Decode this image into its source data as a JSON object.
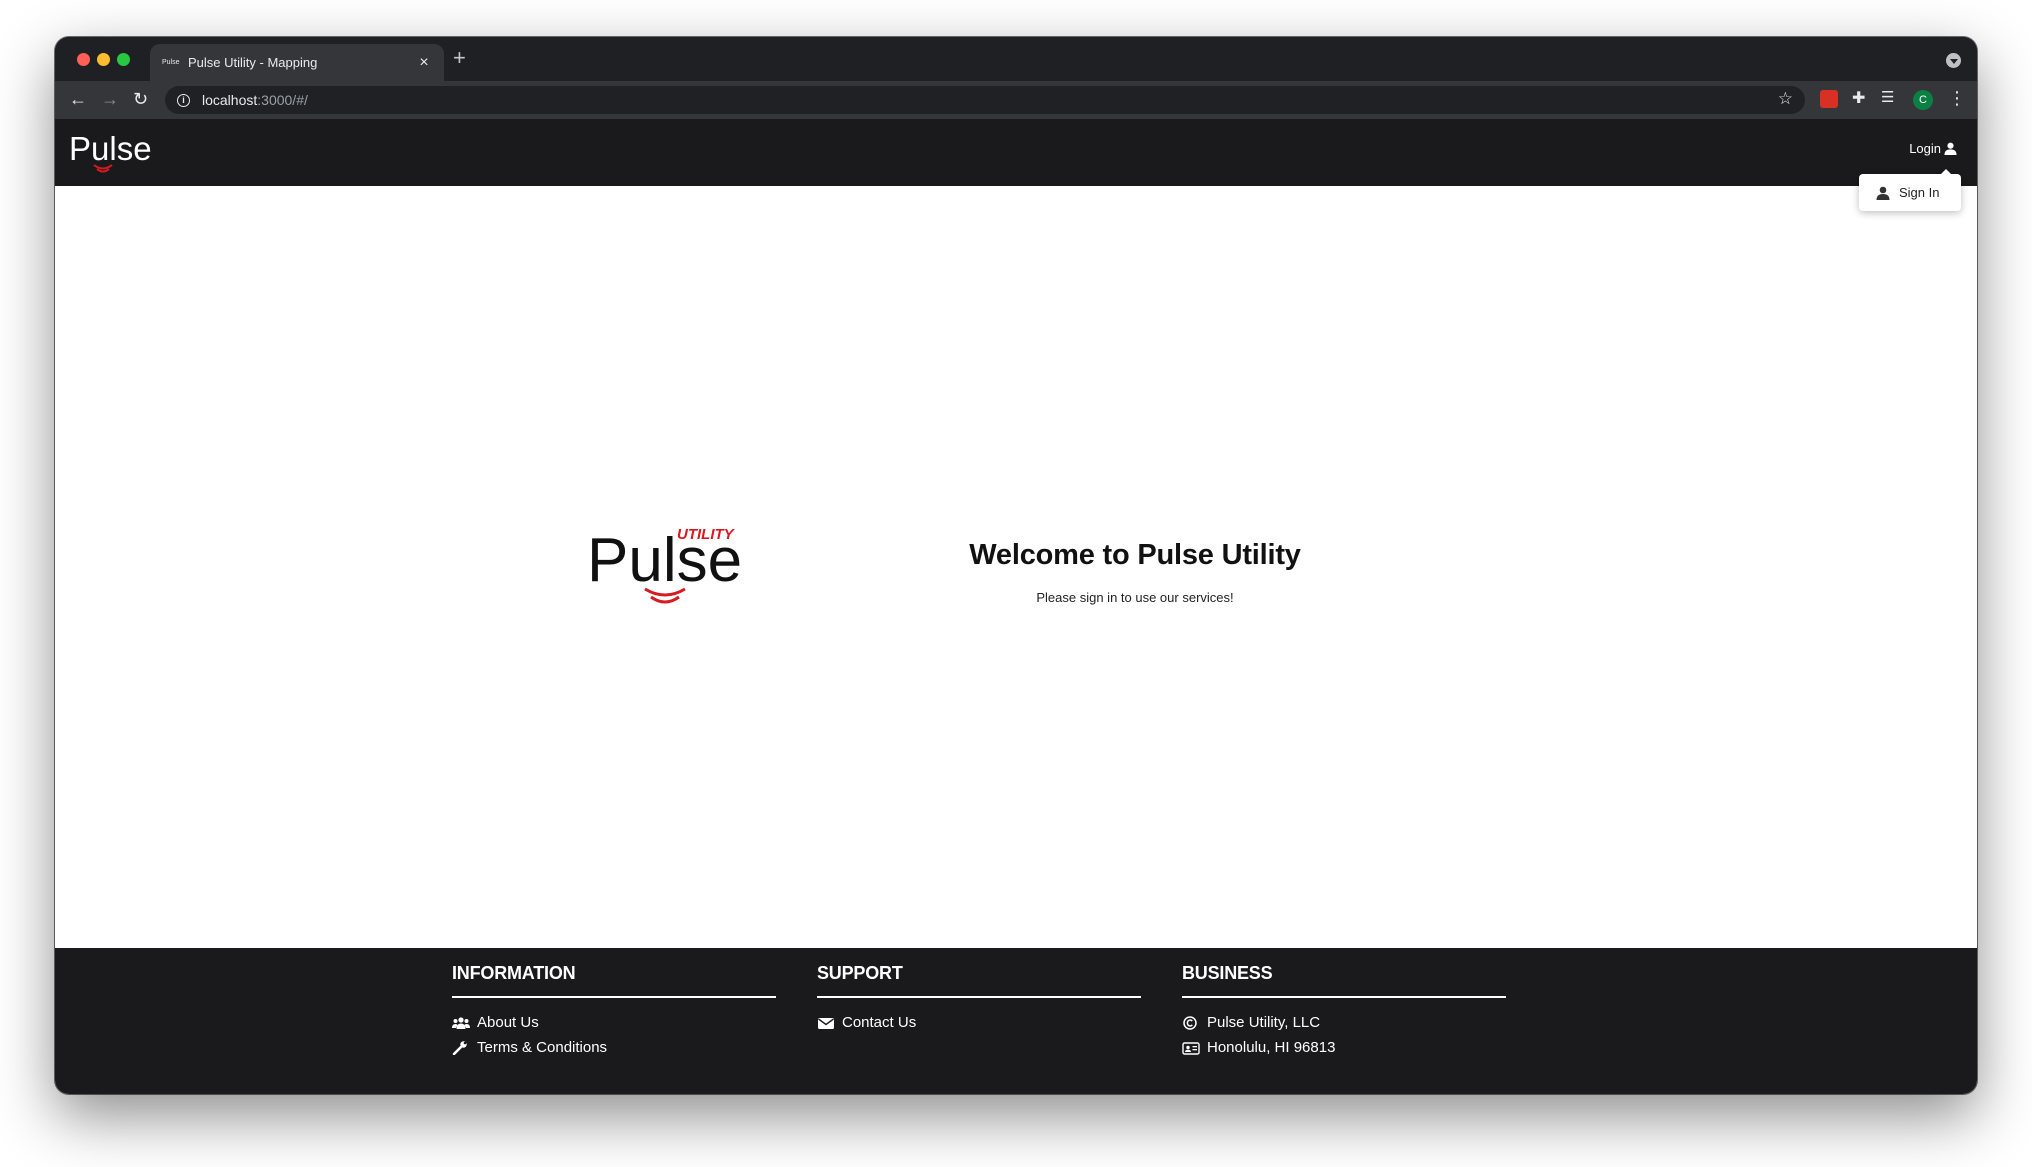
{
  "browser": {
    "tab_title": "Pulse Utility - Mapping",
    "tab_favicon_text": "Pulse",
    "url_host": "localhost",
    "url_rest": ":3000/#/",
    "profile_initial": "C"
  },
  "header": {
    "logo_text": "Pulse",
    "login_label": "Login"
  },
  "dropdown": {
    "sign_in_label": "Sign In"
  },
  "hero": {
    "logo_text": "Pulse",
    "logo_tag": "UTILITY",
    "title": "Welcome to Pulse Utility",
    "subtitle": "Please sign in to use our services!"
  },
  "footer": {
    "columns": [
      {
        "heading": "INFORMATION",
        "items": [
          {
            "icon": "users-icon",
            "label": "About Us"
          },
          {
            "icon": "wrench-icon",
            "label": "Terms & Conditions"
          }
        ]
      },
      {
        "heading": "SUPPORT",
        "items": [
          {
            "icon": "envelope-icon",
            "label": "Contact Us"
          }
        ]
      },
      {
        "heading": "BUSINESS",
        "items": [
          {
            "icon": "copyright-icon",
            "label": "Pulse Utility, LLC"
          },
          {
            "icon": "id-card-icon",
            "label": "Honolulu, HI 96813"
          }
        ]
      }
    ]
  },
  "colors": {
    "brand_red": "#d71920",
    "header_bg": "#1a1a1c",
    "footer_bg": "#1a1a1c"
  }
}
